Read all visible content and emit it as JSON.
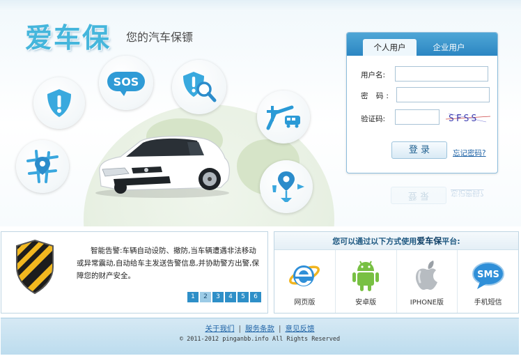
{
  "brand": {
    "logo_text": "爱车保",
    "slogan": "您的汽车保镖"
  },
  "hero": {
    "sos_label": "SOS",
    "icons": [
      "alert-shield-icon",
      "sos-icon",
      "search-shield-icon",
      "route-bus-icon",
      "map-pin-icon",
      "poi-icon"
    ]
  },
  "login": {
    "tabs": [
      {
        "label": "个人用户",
        "active": true
      },
      {
        "label": "企业用户",
        "active": false
      }
    ],
    "username_label": "用户名:",
    "password_label": "密  码:",
    "captcha_label": "验证码:",
    "username_value": "",
    "password_value": "",
    "captcha_value": "",
    "captcha_text": "SFSS",
    "login_button": "登 录",
    "forgot_link": "忘记密码?"
  },
  "feature": {
    "title": "智能告警:",
    "text": "智能告警:车辆自动设防、撤防,当车辆遭遇非法移动或异常震动,自动给车主发送告警信息,并协助警方出警,保障您的财产安全。",
    "pages": [
      "1",
      "2",
      "3",
      "4",
      "5",
      "6"
    ],
    "active_page": 2
  },
  "platforms": {
    "heading_prefix": "您可以通过以下方式使用",
    "heading_brand": "爱车保",
    "heading_suffix": "平台:",
    "items": [
      {
        "label": "网页版",
        "icon": "ie-browser-icon"
      },
      {
        "label": "安卓版",
        "icon": "android-icon"
      },
      {
        "label": "IPHONE版",
        "icon": "apple-icon"
      },
      {
        "label": "手机短信",
        "icon": "sms-icon"
      }
    ],
    "sms_icon_text": "SMS"
  },
  "footer": {
    "links": [
      "关于我们",
      "服务条款",
      "意见反馈"
    ],
    "separator": "|",
    "copyright": "© 2011-2012 pinganbb.info All Rights Reserved"
  },
  "colors": {
    "brand_blue": "#45b6dc",
    "header_blue": "#2b86c2",
    "pager_blue": "#2e8fc8",
    "footer_blue": "#bcdcee"
  }
}
